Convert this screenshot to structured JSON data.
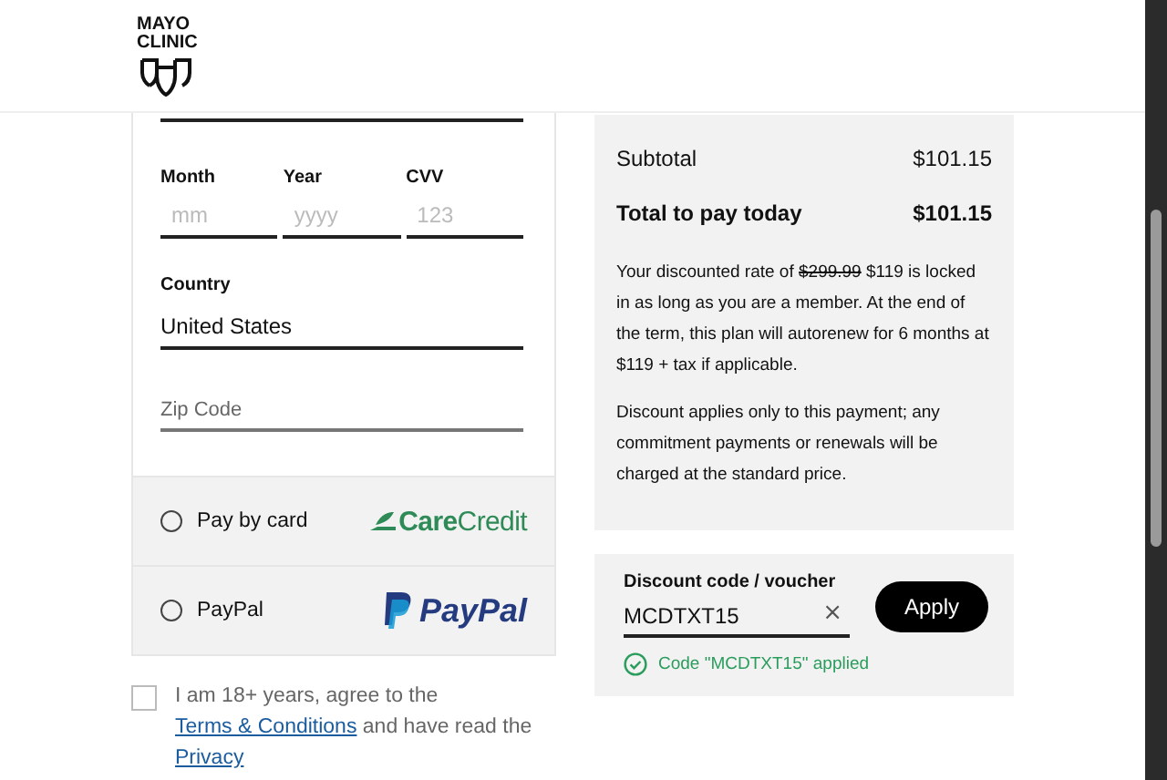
{
  "header": {
    "logo_lines": [
      "MAYO",
      "CLINIC"
    ]
  },
  "card_form": {
    "expiry_fields": [
      {
        "label": "Month",
        "placeholder": "mm"
      },
      {
        "label": "Year",
        "placeholder": "yyyy"
      },
      {
        "label": "CVV",
        "placeholder": "123"
      }
    ],
    "country": {
      "label": "Country",
      "value": "United States"
    },
    "zip": {
      "placeholder": "Zip Code"
    }
  },
  "payment_options": [
    {
      "label": "Pay by card",
      "selected": false,
      "kind": "carecredit",
      "logo": "**Care**Credit"
    },
    {
      "label": "PayPal",
      "selected": false,
      "kind": "paypal",
      "logo": "PayPal"
    }
  ],
  "consent": {
    "checked": false,
    "text_before": "I am 18+ years, agree to the ",
    "terms_link": "Terms & Conditions",
    "text_middle": " and have read the ",
    "privacy_link": "Privacy"
  },
  "summary": {
    "rows": [
      {
        "label": "Subtotal",
        "value": "$101.15",
        "bold": false
      },
      {
        "label": "Total to pay today",
        "value": "$101.15",
        "bold": true
      }
    ],
    "rate_note": {
      "before": "Your discounted rate of ",
      "struck": "$299.99",
      "after": " $119 is locked in as long as you are a member. At the end of the term, this plan will autorenew for 6 months at $119 + tax if applicable."
    },
    "discount_note": "Discount applies only to this payment; any commitment payments or renewals will be charged at the standard price."
  },
  "discount": {
    "label": "Discount code / voucher",
    "value": "MCDTXT15",
    "clear": "×",
    "button": "Apply",
    "status": "Code \"MCDTXT15\" applied"
  }
}
